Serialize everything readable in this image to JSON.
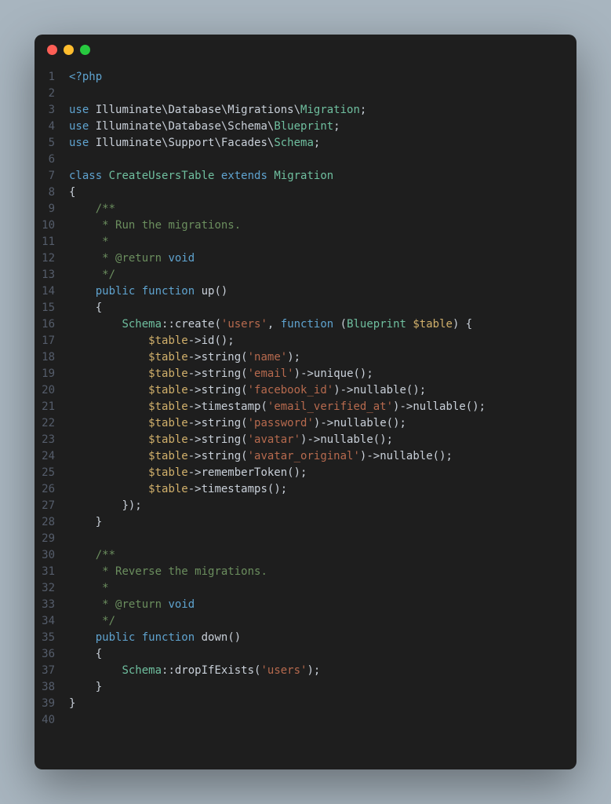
{
  "window": {
    "traffic_lights": [
      "red",
      "yellow",
      "green"
    ]
  },
  "code": {
    "lines": [
      [
        [
          "tag",
          "<?php"
        ]
      ],
      [
        [
          "plain",
          ""
        ]
      ],
      [
        [
          "kw",
          "use"
        ],
        [
          "plain",
          " "
        ],
        [
          "ns",
          "Illuminate\\Database\\Migrations\\"
        ],
        [
          "type",
          "Migration"
        ],
        [
          "punct",
          ";"
        ]
      ],
      [
        [
          "kw",
          "use"
        ],
        [
          "plain",
          " "
        ],
        [
          "ns",
          "Illuminate\\Database\\Schema\\"
        ],
        [
          "type",
          "Blueprint"
        ],
        [
          "punct",
          ";"
        ]
      ],
      [
        [
          "kw",
          "use"
        ],
        [
          "plain",
          " "
        ],
        [
          "ns",
          "Illuminate\\Support\\Facades\\"
        ],
        [
          "type",
          "Schema"
        ],
        [
          "punct",
          ";"
        ]
      ],
      [
        [
          "plain",
          ""
        ]
      ],
      [
        [
          "kw",
          "class"
        ],
        [
          "plain",
          " "
        ],
        [
          "type",
          "CreateUsersTable"
        ],
        [
          "plain",
          " "
        ],
        [
          "kw",
          "extends"
        ],
        [
          "plain",
          " "
        ],
        [
          "type",
          "Migration"
        ]
      ],
      [
        [
          "punct",
          "{"
        ]
      ],
      [
        [
          "plain",
          "    "
        ],
        [
          "comment",
          "/**"
        ]
      ],
      [
        [
          "plain",
          "     "
        ],
        [
          "comment",
          "* Run the migrations."
        ]
      ],
      [
        [
          "plain",
          "     "
        ],
        [
          "comment",
          "*"
        ]
      ],
      [
        [
          "plain",
          "     "
        ],
        [
          "comment",
          "* @return"
        ],
        [
          "plain",
          " "
        ],
        [
          "kw",
          "void"
        ]
      ],
      [
        [
          "plain",
          "     "
        ],
        [
          "comment",
          "*/"
        ]
      ],
      [
        [
          "plain",
          "    "
        ],
        [
          "kw",
          "public"
        ],
        [
          "plain",
          " "
        ],
        [
          "kw",
          "function"
        ],
        [
          "plain",
          " "
        ],
        [
          "func",
          "up"
        ],
        [
          "punct",
          "()"
        ]
      ],
      [
        [
          "plain",
          "    "
        ],
        [
          "punct",
          "{"
        ]
      ],
      [
        [
          "plain",
          "        "
        ],
        [
          "type",
          "Schema"
        ],
        [
          "op",
          "::"
        ],
        [
          "func",
          "create"
        ],
        [
          "punct",
          "("
        ],
        [
          "str",
          "'users'"
        ],
        [
          "punct",
          ", "
        ],
        [
          "kw",
          "function"
        ],
        [
          "plain",
          " "
        ],
        [
          "punct",
          "("
        ],
        [
          "type",
          "Blueprint"
        ],
        [
          "plain",
          " "
        ],
        [
          "var",
          "$table"
        ],
        [
          "punct",
          ") {"
        ]
      ],
      [
        [
          "plain",
          "            "
        ],
        [
          "var",
          "$table"
        ],
        [
          "op",
          "->"
        ],
        [
          "func",
          "id"
        ],
        [
          "punct",
          "();"
        ]
      ],
      [
        [
          "plain",
          "            "
        ],
        [
          "var",
          "$table"
        ],
        [
          "op",
          "->"
        ],
        [
          "func",
          "string"
        ],
        [
          "punct",
          "("
        ],
        [
          "str",
          "'name'"
        ],
        [
          "punct",
          ");"
        ]
      ],
      [
        [
          "plain",
          "            "
        ],
        [
          "var",
          "$table"
        ],
        [
          "op",
          "->"
        ],
        [
          "func",
          "string"
        ],
        [
          "punct",
          "("
        ],
        [
          "str",
          "'email'"
        ],
        [
          "punct",
          ")"
        ],
        [
          "op",
          "->"
        ],
        [
          "func",
          "unique"
        ],
        [
          "punct",
          "();"
        ]
      ],
      [
        [
          "plain",
          "            "
        ],
        [
          "var",
          "$table"
        ],
        [
          "op",
          "->"
        ],
        [
          "func",
          "string"
        ],
        [
          "punct",
          "("
        ],
        [
          "str",
          "'facebook_id'"
        ],
        [
          "punct",
          ")"
        ],
        [
          "op",
          "->"
        ],
        [
          "func",
          "nullable"
        ],
        [
          "punct",
          "();"
        ]
      ],
      [
        [
          "plain",
          "            "
        ],
        [
          "var",
          "$table"
        ],
        [
          "op",
          "->"
        ],
        [
          "func",
          "timestamp"
        ],
        [
          "punct",
          "("
        ],
        [
          "str",
          "'email_verified_at'"
        ],
        [
          "punct",
          ")"
        ],
        [
          "op",
          "->"
        ],
        [
          "func",
          "nullable"
        ],
        [
          "punct",
          "();"
        ]
      ],
      [
        [
          "plain",
          "            "
        ],
        [
          "var",
          "$table"
        ],
        [
          "op",
          "->"
        ],
        [
          "func",
          "string"
        ],
        [
          "punct",
          "("
        ],
        [
          "str",
          "'password'"
        ],
        [
          "punct",
          ")"
        ],
        [
          "op",
          "->"
        ],
        [
          "func",
          "nullable"
        ],
        [
          "punct",
          "();"
        ]
      ],
      [
        [
          "plain",
          "            "
        ],
        [
          "var",
          "$table"
        ],
        [
          "op",
          "->"
        ],
        [
          "func",
          "string"
        ],
        [
          "punct",
          "("
        ],
        [
          "str",
          "'avatar'"
        ],
        [
          "punct",
          ")"
        ],
        [
          "op",
          "->"
        ],
        [
          "func",
          "nullable"
        ],
        [
          "punct",
          "();"
        ]
      ],
      [
        [
          "plain",
          "            "
        ],
        [
          "var",
          "$table"
        ],
        [
          "op",
          "->"
        ],
        [
          "func",
          "string"
        ],
        [
          "punct",
          "("
        ],
        [
          "str",
          "'avatar_original'"
        ],
        [
          "punct",
          ")"
        ],
        [
          "op",
          "->"
        ],
        [
          "func",
          "nullable"
        ],
        [
          "punct",
          "();"
        ]
      ],
      [
        [
          "plain",
          "            "
        ],
        [
          "var",
          "$table"
        ],
        [
          "op",
          "->"
        ],
        [
          "func",
          "rememberToken"
        ],
        [
          "punct",
          "();"
        ]
      ],
      [
        [
          "plain",
          "            "
        ],
        [
          "var",
          "$table"
        ],
        [
          "op",
          "->"
        ],
        [
          "func",
          "timestamps"
        ],
        [
          "punct",
          "();"
        ]
      ],
      [
        [
          "plain",
          "        "
        ],
        [
          "punct",
          "});"
        ]
      ],
      [
        [
          "plain",
          "    "
        ],
        [
          "punct",
          "}"
        ]
      ],
      [
        [
          "plain",
          ""
        ]
      ],
      [
        [
          "plain",
          "    "
        ],
        [
          "comment",
          "/**"
        ]
      ],
      [
        [
          "plain",
          "     "
        ],
        [
          "comment",
          "* Reverse the migrations."
        ]
      ],
      [
        [
          "plain",
          "     "
        ],
        [
          "comment",
          "*"
        ]
      ],
      [
        [
          "plain",
          "     "
        ],
        [
          "comment",
          "* @return"
        ],
        [
          "plain",
          " "
        ],
        [
          "kw",
          "void"
        ]
      ],
      [
        [
          "plain",
          "     "
        ],
        [
          "comment",
          "*/"
        ]
      ],
      [
        [
          "plain",
          "    "
        ],
        [
          "kw",
          "public"
        ],
        [
          "plain",
          " "
        ],
        [
          "kw",
          "function"
        ],
        [
          "plain",
          " "
        ],
        [
          "func",
          "down"
        ],
        [
          "punct",
          "()"
        ]
      ],
      [
        [
          "plain",
          "    "
        ],
        [
          "punct",
          "{"
        ]
      ],
      [
        [
          "plain",
          "        "
        ],
        [
          "type",
          "Schema"
        ],
        [
          "op",
          "::"
        ],
        [
          "func",
          "dropIfExists"
        ],
        [
          "punct",
          "("
        ],
        [
          "str",
          "'users'"
        ],
        [
          "punct",
          ");"
        ]
      ],
      [
        [
          "plain",
          "    "
        ],
        [
          "punct",
          "}"
        ]
      ],
      [
        [
          "punct",
          "}"
        ]
      ],
      [
        [
          "plain",
          ""
        ]
      ]
    ]
  }
}
